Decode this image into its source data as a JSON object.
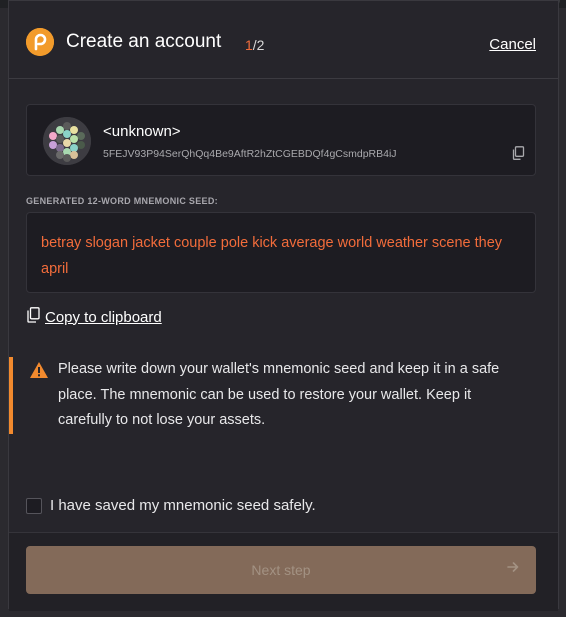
{
  "header": {
    "title": "Create an account",
    "step_current": "1",
    "step_total": "/2",
    "cancel_label": "Cancel"
  },
  "account": {
    "name": "<unknown>",
    "address": "5FEJV93P94SerQhQq4Be9AftR2hZtCGEBDQf4gCsmdpRB4iJ"
  },
  "seed": {
    "label": "GENERATED 12-WORD MNEMONIC SEED:",
    "phrase": "betray slogan jacket couple pole kick average world weather scene they april",
    "copy_label": "Copy to clipboard"
  },
  "warning": {
    "text": "Please write down your wallet's mnemonic seed and keep it in a safe place. The mnemonic can be used to restore your wallet. Keep it carefully to not lose your assets."
  },
  "confirm": {
    "label": "I have saved my mnemonic seed safely.",
    "checked": false
  },
  "footer": {
    "next_label": "Next step"
  },
  "colors": {
    "accent": "#f26c3b",
    "logo": "#f29b2b",
    "warning": "#f28a2e",
    "button_disabled": "#836a59"
  },
  "icons": [
    "polkadot-logo-icon",
    "copy-icon",
    "warning-icon",
    "arrow-right-icon"
  ]
}
